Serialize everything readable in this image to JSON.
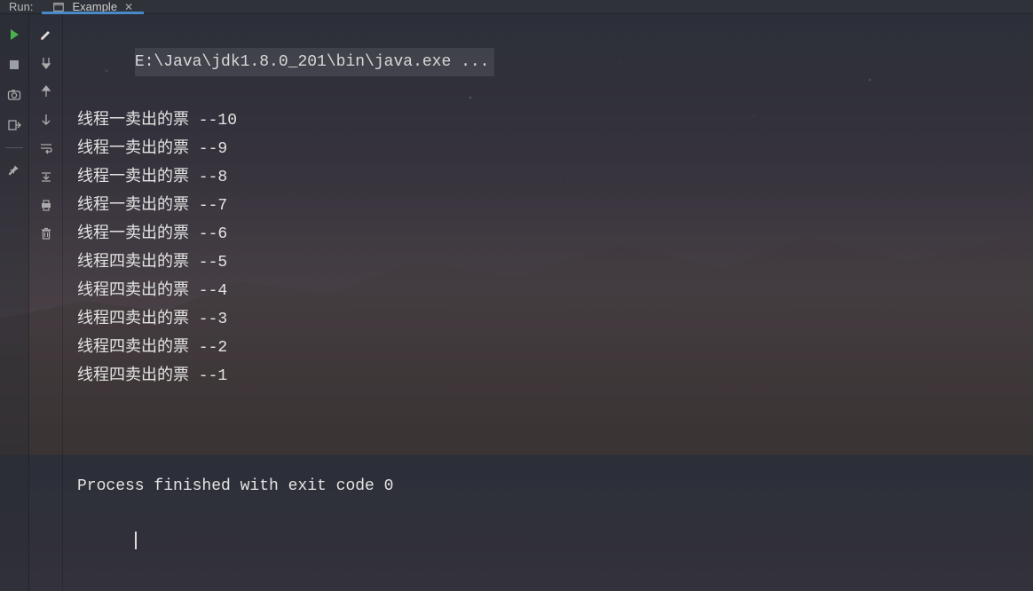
{
  "header": {
    "run_label": "Run:",
    "tab_label": "Example"
  },
  "console": {
    "command": "E:\\Java\\jdk1.8.0_201\\bin\\java.exe ...",
    "lines": [
      {
        "prefix": "线程一卖出的票",
        "sep": " --",
        "value": "10"
      },
      {
        "prefix": "线程一卖出的票",
        "sep": " --",
        "value": "9"
      },
      {
        "prefix": "线程一卖出的票",
        "sep": " --",
        "value": "8"
      },
      {
        "prefix": "线程一卖出的票",
        "sep": " --",
        "value": "7"
      },
      {
        "prefix": "线程一卖出的票",
        "sep": " --",
        "value": "6"
      },
      {
        "prefix": "线程四卖出的票",
        "sep": " --",
        "value": "5"
      },
      {
        "prefix": "线程四卖出的票",
        "sep": " --",
        "value": "4"
      },
      {
        "prefix": "线程四卖出的票",
        "sep": " --",
        "value": "3"
      },
      {
        "prefix": "线程四卖出的票",
        "sep": " --",
        "value": "2"
      },
      {
        "prefix": "线程四卖出的票",
        "sep": " --",
        "value": "1"
      }
    ],
    "exit_message": "Process finished with exit code 0"
  }
}
